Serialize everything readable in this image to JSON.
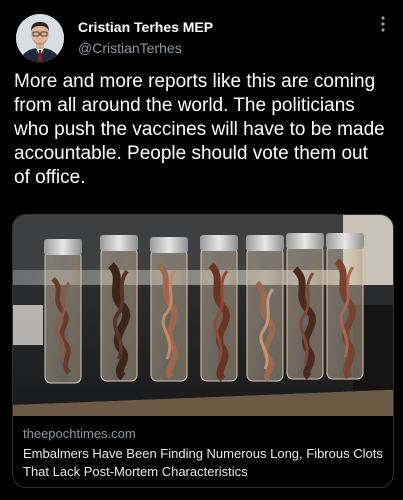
{
  "author": {
    "name": "Cristian Terhes MEP",
    "handle": "@CristianTerhes"
  },
  "tweet": {
    "text": "More and more reports like this are coming from all around the world. The politicians who push the vaccines will have to be made accountable. People should vote them out of office."
  },
  "link_card": {
    "domain": "theepochtimes.com",
    "title": "Embalmers Have Been Finding Numerous Long, Fibrous Clots That Lack Post-Mortem Characteristics"
  },
  "icons": {
    "more": "more-vertical-icon"
  },
  "colors": {
    "background": "#000000",
    "text": "#ffffff",
    "secondary_text": "#8b98a5",
    "card_border": "#2f3336"
  }
}
